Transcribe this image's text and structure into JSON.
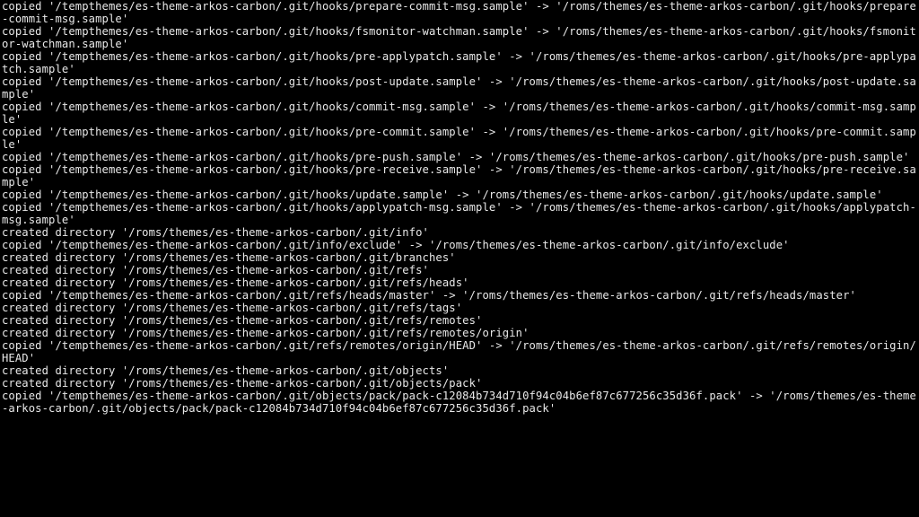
{
  "terminal": {
    "lines": [
      "copied '/tempthemes/es-theme-arkos-carbon/.git/hooks/prepare-commit-msg.sample' -> '/roms/themes/es-theme-arkos-carbon/.git/hooks/prepare-commit-msg.sample'",
      "copied '/tempthemes/es-theme-arkos-carbon/.git/hooks/fsmonitor-watchman.sample' -> '/roms/themes/es-theme-arkos-carbon/.git/hooks/fsmonitor-watchman.sample'",
      "copied '/tempthemes/es-theme-arkos-carbon/.git/hooks/pre-applypatch.sample' -> '/roms/themes/es-theme-arkos-carbon/.git/hooks/pre-applypatch.sample'",
      "copied '/tempthemes/es-theme-arkos-carbon/.git/hooks/post-update.sample' -> '/roms/themes/es-theme-arkos-carbon/.git/hooks/post-update.sample'",
      "copied '/tempthemes/es-theme-arkos-carbon/.git/hooks/commit-msg.sample' -> '/roms/themes/es-theme-arkos-carbon/.git/hooks/commit-msg.sample'",
      "copied '/tempthemes/es-theme-arkos-carbon/.git/hooks/pre-commit.sample' -> '/roms/themes/es-theme-arkos-carbon/.git/hooks/pre-commit.sample'",
      "copied '/tempthemes/es-theme-arkos-carbon/.git/hooks/pre-push.sample' -> '/roms/themes/es-theme-arkos-carbon/.git/hooks/pre-push.sample'",
      "copied '/tempthemes/es-theme-arkos-carbon/.git/hooks/pre-receive.sample' -> '/roms/themes/es-theme-arkos-carbon/.git/hooks/pre-receive.sample'",
      "copied '/tempthemes/es-theme-arkos-carbon/.git/hooks/update.sample' -> '/roms/themes/es-theme-arkos-carbon/.git/hooks/update.sample'",
      "copied '/tempthemes/es-theme-arkos-carbon/.git/hooks/applypatch-msg.sample' -> '/roms/themes/es-theme-arkos-carbon/.git/hooks/applypatch-msg.sample'",
      "created directory '/roms/themes/es-theme-arkos-carbon/.git/info'",
      "copied '/tempthemes/es-theme-arkos-carbon/.git/info/exclude' -> '/roms/themes/es-theme-arkos-carbon/.git/info/exclude'",
      "created directory '/roms/themes/es-theme-arkos-carbon/.git/branches'",
      "created directory '/roms/themes/es-theme-arkos-carbon/.git/refs'",
      "created directory '/roms/themes/es-theme-arkos-carbon/.git/refs/heads'",
      "copied '/tempthemes/es-theme-arkos-carbon/.git/refs/heads/master' -> '/roms/themes/es-theme-arkos-carbon/.git/refs/heads/master'",
      "created directory '/roms/themes/es-theme-arkos-carbon/.git/refs/tags'",
      "created directory '/roms/themes/es-theme-arkos-carbon/.git/refs/remotes'",
      "created directory '/roms/themes/es-theme-arkos-carbon/.git/refs/remotes/origin'",
      "copied '/tempthemes/es-theme-arkos-carbon/.git/refs/remotes/origin/HEAD' -> '/roms/themes/es-theme-arkos-carbon/.git/refs/remotes/origin/HEAD'",
      "created directory '/roms/themes/es-theme-arkos-carbon/.git/objects'",
      "created directory '/roms/themes/es-theme-arkos-carbon/.git/objects/pack'",
      "copied '/tempthemes/es-theme-arkos-carbon/.git/objects/pack/pack-c12084b734d710f94c04b6ef87c677256c35d36f.pack' -> '/roms/themes/es-theme-arkos-carbon/.git/objects/pack/pack-c12084b734d710f94c04b6ef87c677256c35d36f.pack'"
    ]
  }
}
